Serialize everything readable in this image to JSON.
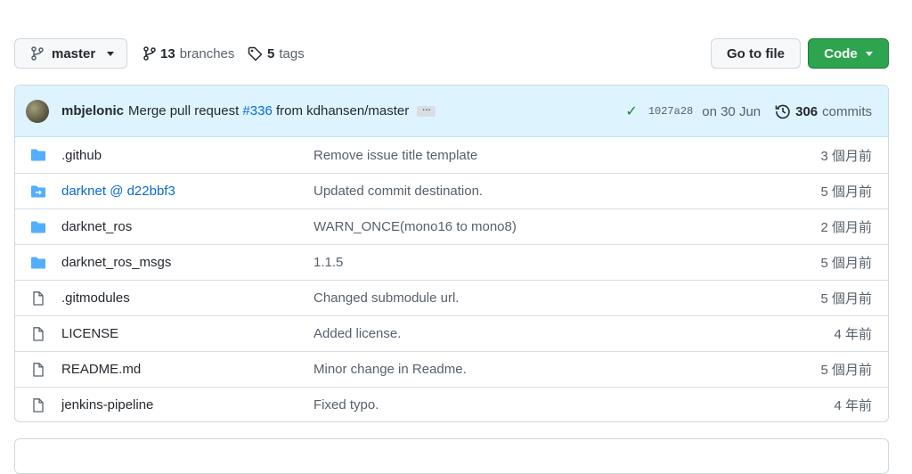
{
  "toolbar": {
    "branch": "master",
    "branches_count": "13",
    "branches_label": "branches",
    "tags_count": "5",
    "tags_label": "tags",
    "goto_file": "Go to file",
    "code": "Code"
  },
  "commit": {
    "author": "mbjelonic",
    "message_prefix": "Merge pull request",
    "pr": "#336",
    "message_suffix": "from kdhansen/master",
    "ellipsis": "…",
    "sha": "1027a28",
    "date": "on 30 Jun",
    "commits_count": "306",
    "commits_label": "commits"
  },
  "files": [
    {
      "type": "folder",
      "name": ".github",
      "message": "Remove issue title template",
      "age": "3 個月前"
    },
    {
      "type": "submodule",
      "name": "darknet @ d22bbf3",
      "message": "Updated commit destination.",
      "age": "5 個月前"
    },
    {
      "type": "folder",
      "name": "darknet_ros",
      "message": "WARN_ONCE(mono16 to mono8)",
      "age": "2 個月前"
    },
    {
      "type": "folder",
      "name": "darknet_ros_msgs",
      "message": "1.1.5",
      "age": "5 個月前"
    },
    {
      "type": "file",
      "name": ".gitmodules",
      "message": "Changed submodule url.",
      "age": "5 個月前"
    },
    {
      "type": "file",
      "name": "LICENSE",
      "message": "Added license.",
      "age": "4 年前"
    },
    {
      "type": "file",
      "name": "README.md",
      "message": "Minor change in Readme.",
      "age": "5 個月前"
    },
    {
      "type": "file",
      "name": "jenkins-pipeline",
      "message": "Fixed typo.",
      "age": "4 年前"
    }
  ],
  "colors": {
    "folder": "#54aeff",
    "file": "#57606a",
    "link": "#0969da",
    "primary_button": "#2da44e",
    "commit_bar": "#ddf4ff"
  }
}
